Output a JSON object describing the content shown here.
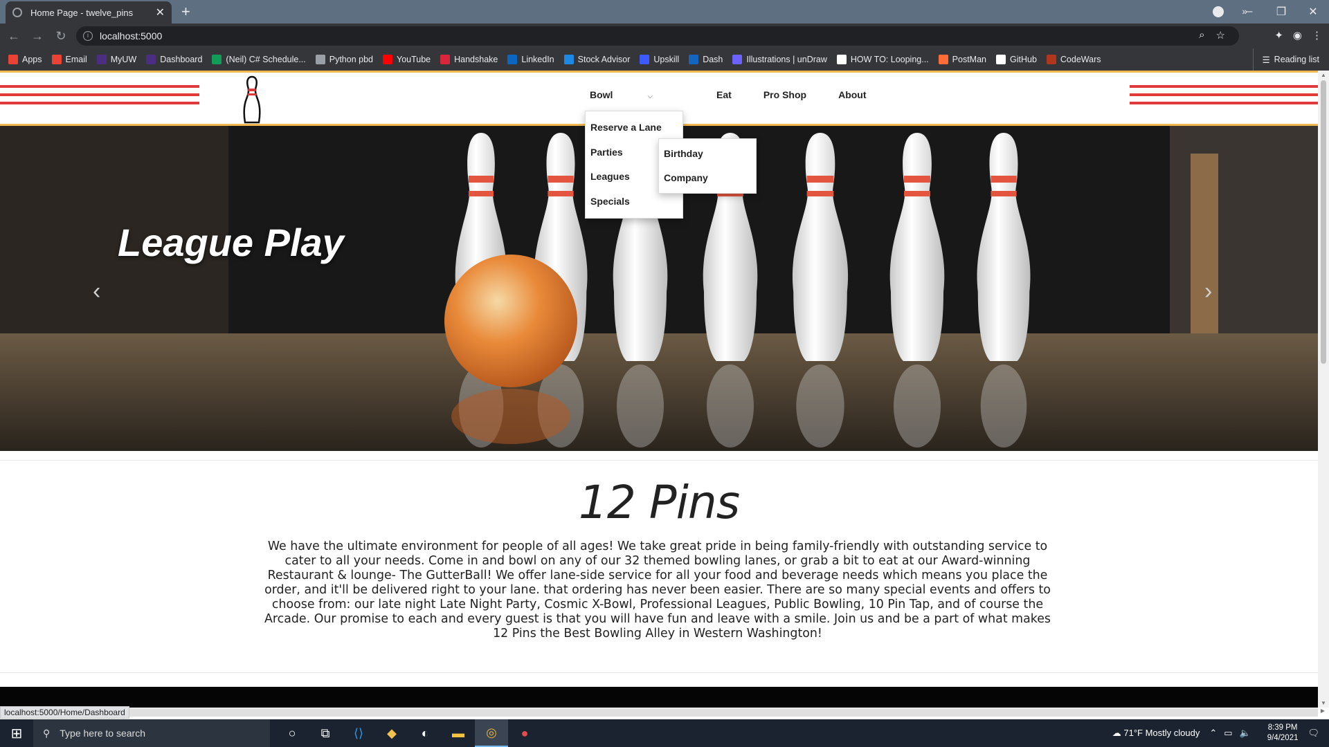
{
  "browser": {
    "tab_title": "Home Page - twelve_pins",
    "tab_close": "✕",
    "new_tab": "+",
    "url": "localhost:5000",
    "bookmarks": [
      {
        "label": "Apps",
        "color": "#ea4335"
      },
      {
        "label": "Email",
        "color": "#ea4335"
      },
      {
        "label": "MyUW",
        "color": "#4b2e83"
      },
      {
        "label": "Dashboard",
        "color": "#4b2e83"
      },
      {
        "label": "(Neil) C# Schedule...",
        "color": "#0f9d58"
      },
      {
        "label": "Python pbd",
        "color": "#9aa0a6"
      },
      {
        "label": "YouTube",
        "color": "#ff0000"
      },
      {
        "label": "Handshake",
        "color": "#d9263b"
      },
      {
        "label": "LinkedIn",
        "color": "#0a66c2"
      },
      {
        "label": "Stock Advisor",
        "color": "#1e88e5"
      },
      {
        "label": "Upskill",
        "color": "#3d5afe"
      },
      {
        "label": "Dash",
        "color": "#1565c0"
      },
      {
        "label": "Illustrations | unDraw",
        "color": "#6c63ff"
      },
      {
        "label": "HOW TO: Looping...",
        "color": "#ffffff"
      },
      {
        "label": "PostMan",
        "color": "#ff6c37"
      },
      {
        "label": "GitHub",
        "color": "#ffffff"
      },
      {
        "label": "CodeWars",
        "color": "#b1361e"
      }
    ],
    "bookmarks_more": "»",
    "reading_list": "Reading list",
    "status_url": "localhost:5000/Home/Dashboard"
  },
  "site": {
    "nav": {
      "bowl": "Bowl",
      "eat": "Eat",
      "pro_shop": "Pro Shop",
      "about": "About"
    },
    "bowl_menu": [
      "Reserve a Lane",
      "Parties",
      "Leagues",
      "Specials"
    ],
    "leagues_submenu": [
      "Birthday",
      "Company"
    ],
    "hero_title": "League Play",
    "hero_prev": "‹",
    "hero_next": "›",
    "heading": "12 Pins",
    "intro": "We have the ultimate environment for people of all ages! We take great pride in being family-friendly with outstanding service to cater to all your needs. Come in and bowl on any of our 32 themed bowling lanes, or grab a bit to eat at our Award-winning Restaurant & lounge- The GutterBall! We offer lane-side service for all your food and beverage needs which means you place the order, and it'll be delivered right to your lane. that ordering has never been easier. There are so many special events and offers to choose from: our late night Late Night Party, Cosmic X-Bowl, Professional Leagues, Public Bowling, 10 Pin Tap, and of course the Arcade. Our promise to each and every guest is that you will have fun and leave with a smile. Join us and be a part of what makes 12 Pins the Best Bowling Alley in Western Washington!"
  },
  "taskbar": {
    "search_placeholder": "Type here to search",
    "weather": "71°F  Mostly cloudy",
    "time": "8:39 PM",
    "date": "9/4/2021"
  }
}
